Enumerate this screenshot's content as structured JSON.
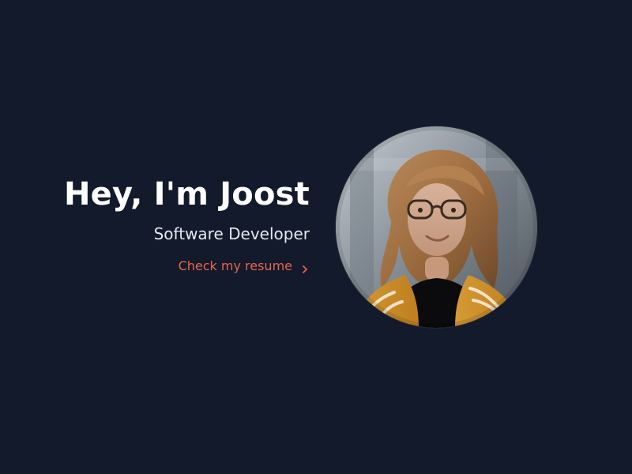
{
  "hero": {
    "headline": "Hey, I'm Joost",
    "subtitle": "Software Developer",
    "resume_link": "Check my resume"
  },
  "icons": {
    "resume_link_icon": "chevron-right-icon"
  },
  "colors": {
    "background": "#121a2b",
    "headline": "#ffffff",
    "subtitle": "#e6e8ee",
    "accent": "#e7664a"
  }
}
